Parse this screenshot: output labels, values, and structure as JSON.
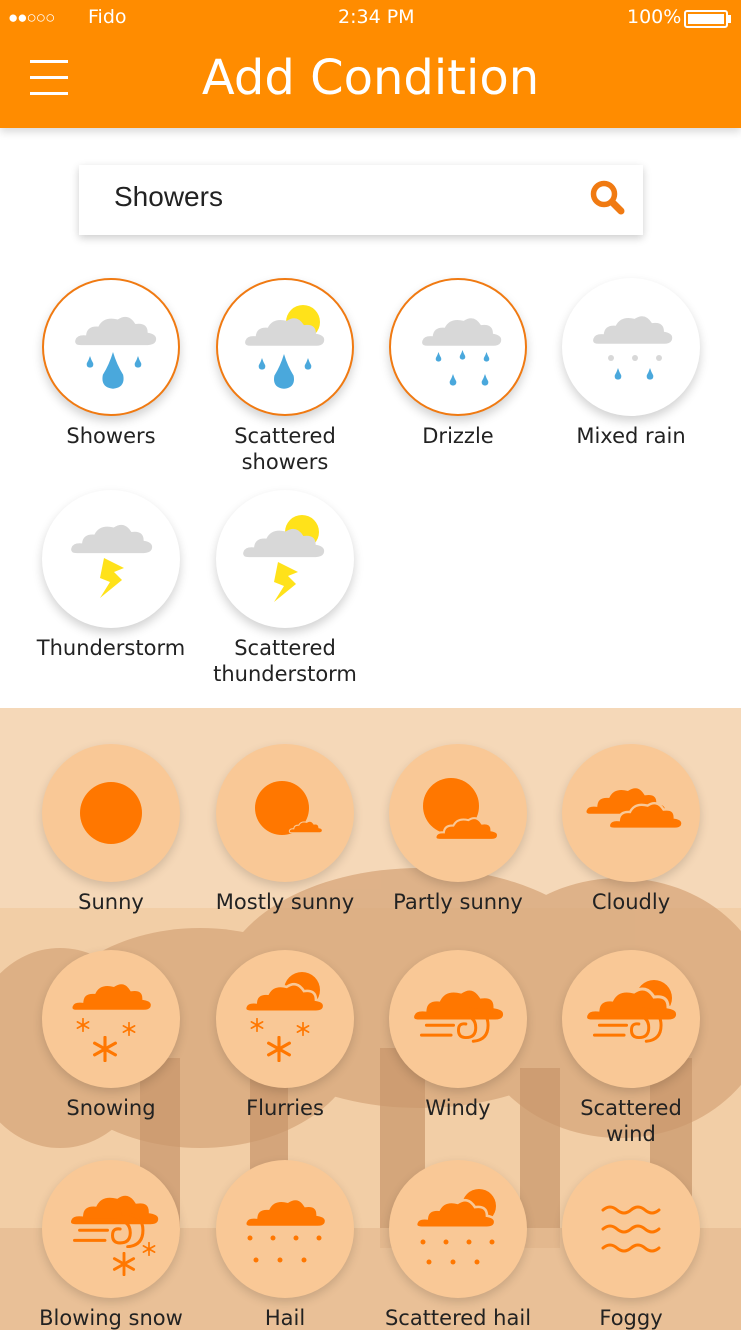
{
  "status_bar": {
    "carrier": "Fido",
    "time": "2:34 PM",
    "battery": "100%"
  },
  "header": {
    "title": "Add Condition"
  },
  "search": {
    "value": "Showers",
    "placeholder": ""
  },
  "results": [
    {
      "label": "Showers",
      "icon": "rain-cloud-icon",
      "selected": true
    },
    {
      "label": "Scattered\nshowers",
      "icon": "sun-rain-cloud-icon",
      "selected": true
    },
    {
      "label": "Drizzle",
      "icon": "drizzle-icon",
      "selected": true
    },
    {
      "label": "Mixed rain",
      "icon": "mixed-rain-icon",
      "selected": false
    },
    {
      "label": "Thunderstorm",
      "icon": "thunderstorm-icon",
      "selected": false
    },
    {
      "label": "Scattered\nthunderstorm",
      "icon": "sun-thunderstorm-icon",
      "selected": false
    }
  ],
  "conditions": [
    {
      "label": "Sunny",
      "icon": "sun-icon"
    },
    {
      "label": "Mostly sunny",
      "icon": "mostly-sunny-icon"
    },
    {
      "label": "Partly sunny",
      "icon": "partly-sunny-icon"
    },
    {
      "label": "Cloudly",
      "icon": "cloud-icon"
    },
    {
      "label": "Snowing",
      "icon": "snow-icon"
    },
    {
      "label": "Flurries",
      "icon": "flurries-icon"
    },
    {
      "label": "Windy",
      "icon": "wind-icon"
    },
    {
      "label": "Scattered\nwind",
      "icon": "sun-wind-icon"
    },
    {
      "label": "Blowing snow",
      "icon": "blowing-snow-icon"
    },
    {
      "label": "Hail",
      "icon": "hail-icon"
    },
    {
      "label": "Scattered hail",
      "icon": "sun-hail-icon"
    },
    {
      "label": "Foggy",
      "icon": "fog-icon"
    }
  ],
  "colors": {
    "accent": "#ff8c00",
    "icon_orange": "#ff7700",
    "peach": "#f9c896",
    "rain_blue": "#4aa8dc",
    "sun_yellow": "#ffe21a",
    "cloud_gray": "#d8d8d8"
  }
}
